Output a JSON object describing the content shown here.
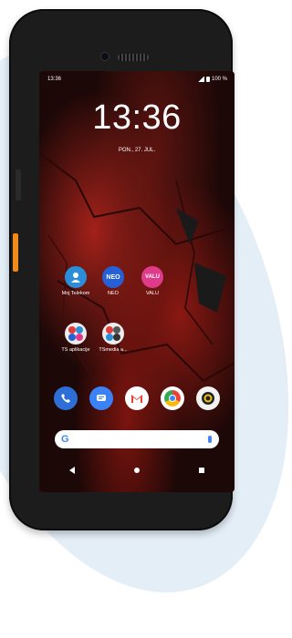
{
  "status_bar": {
    "time": "13:36",
    "battery_text": "100 %"
  },
  "lock": {
    "clock": "13:36",
    "date": "PON., 27. JUL."
  },
  "apps": [
    {
      "label": "Moj Telekom",
      "icon": "person-icon",
      "color": "#2a8fd8",
      "glyph": ""
    },
    {
      "label": "NEO",
      "icon": "neo-icon",
      "color": "#2560d6",
      "glyph": "NEO"
    },
    {
      "label": "VALU",
      "icon": "valu-icon",
      "color": "#e03b8a",
      "glyph": "VALU"
    },
    {
      "label": "TS aplikacije",
      "icon": "folder-icon",
      "color": "#ececec",
      "glyph": ""
    },
    {
      "label": "TSmedia a...",
      "icon": "folder-icon",
      "color": "#ececec",
      "glyph": ""
    }
  ],
  "dock": [
    {
      "icon": "phone-icon",
      "color": "#2d6fd6"
    },
    {
      "icon": "messages-icon",
      "color": "#3b82f6"
    },
    {
      "icon": "gmail-icon",
      "color": "#ffffff"
    },
    {
      "icon": "chrome-icon",
      "color": "#ffffff"
    },
    {
      "icon": "camera-icon",
      "color": "#f2f2f2"
    }
  ],
  "search": {
    "logo": "G"
  }
}
